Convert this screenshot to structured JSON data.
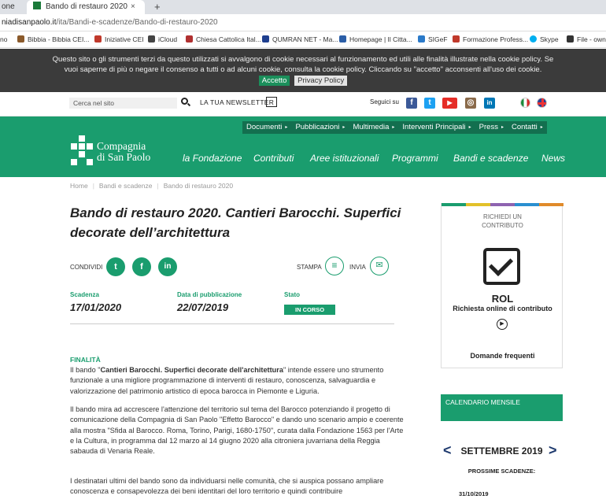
{
  "browser": {
    "tab_prev": "one",
    "tab_active": "Bando di restauro 2020",
    "tab_close": "×",
    "new_tab": "+",
    "url_domain": "niadisanpaolo.it",
    "url_path": "/ita/Bandi-e-scadenze/Bando-di-restauro-2020",
    "bookmarks": [
      {
        "label": "no",
        "color": "#888"
      },
      {
        "label": "Bibbia - Bibbia CEI...",
        "color": "#8b5a2b"
      },
      {
        "label": "Iniziative CEI",
        "color": "#c0392b"
      },
      {
        "label": "iCloud",
        "color": "#444"
      },
      {
        "label": "Chiesa Cattolica Ital...",
        "color": "#b03030"
      },
      {
        "label": "QUMRAN NET - Ma...",
        "color": "#1f3f8f"
      },
      {
        "label": "Homepage | Il Citta...",
        "color": "#2b5ea7"
      },
      {
        "label": "SIGeF",
        "color": "#2b7ac9"
      },
      {
        "label": "Formazione Profess...",
        "color": "#c0392b"
      },
      {
        "label": "Skype",
        "color": "#00aff0"
      },
      {
        "label": "File - own",
        "color": "#333"
      }
    ]
  },
  "cookie": {
    "line1": "Questo sito o gli strumenti terzi da questo utilizzati si avvalgono di cookie necessari al funzionamento ed utili alle finalità illustrate nella cookie policy. Se",
    "line2": "vuoi saperne di più o negare il consenso a tutti o ad alcuni cookie, consulta la cookie policy. Cliccando su \"accetto\" acconsenti all'uso dei cookie.",
    "accept": "Accetto",
    "privacy": "Privacy Policy"
  },
  "topbar": {
    "search_placeholder": "Cerca nel sito",
    "newsletter": "LA TUA NEWSLETTER",
    "follow": "Seguici su",
    "social": [
      {
        "name": "facebook-icon",
        "glyph": "f",
        "color": "#3b5998"
      },
      {
        "name": "twitter-icon",
        "glyph": "t",
        "color": "#1da1f2"
      },
      {
        "name": "youtube-icon",
        "glyph": "▶",
        "color": "#e52d27"
      },
      {
        "name": "instagram-icon",
        "glyph": "◎",
        "color": "#8a6a4a"
      },
      {
        "name": "linkedin-icon",
        "glyph": "in",
        "color": "#0077b5"
      }
    ]
  },
  "header": {
    "subnav": [
      "Documenti",
      "Pubblicazioni",
      "Multimedia",
      "Interventi Principali",
      "Press",
      "Contatti"
    ],
    "logo_line1": "Compagnia",
    "logo_line2": "di San Paolo",
    "nav": [
      "la Fondazione",
      "Contributi",
      "Aree istituzionali",
      "Programmi",
      "Bandi e scadenze",
      "News"
    ]
  },
  "breadcrumb": [
    "Home",
    "Bandi e scadenze",
    "Bando di restauro 2020"
  ],
  "article": {
    "title": "Bando di restauro 2020. Cantieri Barocchi. Superfici decorate dell’architettura",
    "share_label": "CONDIVIDI",
    "print_label": "STAMPA",
    "send_label": "INVIA",
    "scadenza_label": "Scadenza",
    "scadenza": "17/01/2020",
    "pubblicazione_label": "Data di pubblicazione",
    "pubblicazione": "22/07/2019",
    "stato_label": "Stato",
    "stato": "IN CORSO",
    "finalita": "FINALITÀ",
    "p1_a": "Il bando \"",
    "p1_b": "Cantieri Barocchi. Superfici decorate dell'architettura",
    "p1_c": "\" intende essere uno strumento funzionale a una migliore programmazione di interventi di restauro, conoscenza, salvaguardia e valorizzazione del patrimonio artistico di epoca barocca in Piemonte e Liguria.",
    "p2": "Il bando mira ad accrescere l'attenzione del territorio sul tema del Barocco potenziando il progetto di comunicazione della Compagnia di San Paolo \"Effetto Barocco\" e dando uno scenario ampio e coerente alla mostra \"Sfida al Barocco. Roma, Torino, Parigi, 1680-1750\", curata dalla Fondazione 1563 per l'Arte e la Cultura, in programma dal 12 marzo al 14 giugno 2020 alla citroniera juvarriana della Reggia sabauda di Venaria Reale.",
    "p3": "I destinatari ultimi del bando sono da individuarsi nelle comunità, che si auspica possano ampliare conoscenza e consapevolezza dei beni identitari del loro territorio e quindi contribuire"
  },
  "sidebar": {
    "request": "RICHIEDI UN CONTRIBUTO",
    "rol": "ROL",
    "rol_desc": "Richiesta online di contributo",
    "faq": "Domande frequenti",
    "stripe_colors": [
      "#1a9d6e",
      "#e2c12a",
      "#8e63b0",
      "#2a8fd0",
      "#e08a2a"
    ],
    "calendar_title": "CALENDARIO MENSILE",
    "month": "SETTEMBRE 2019",
    "prev": "<",
    "next": ">",
    "upcoming": "PROSSIME SCADENZE:",
    "date1": "31/10/2019"
  }
}
